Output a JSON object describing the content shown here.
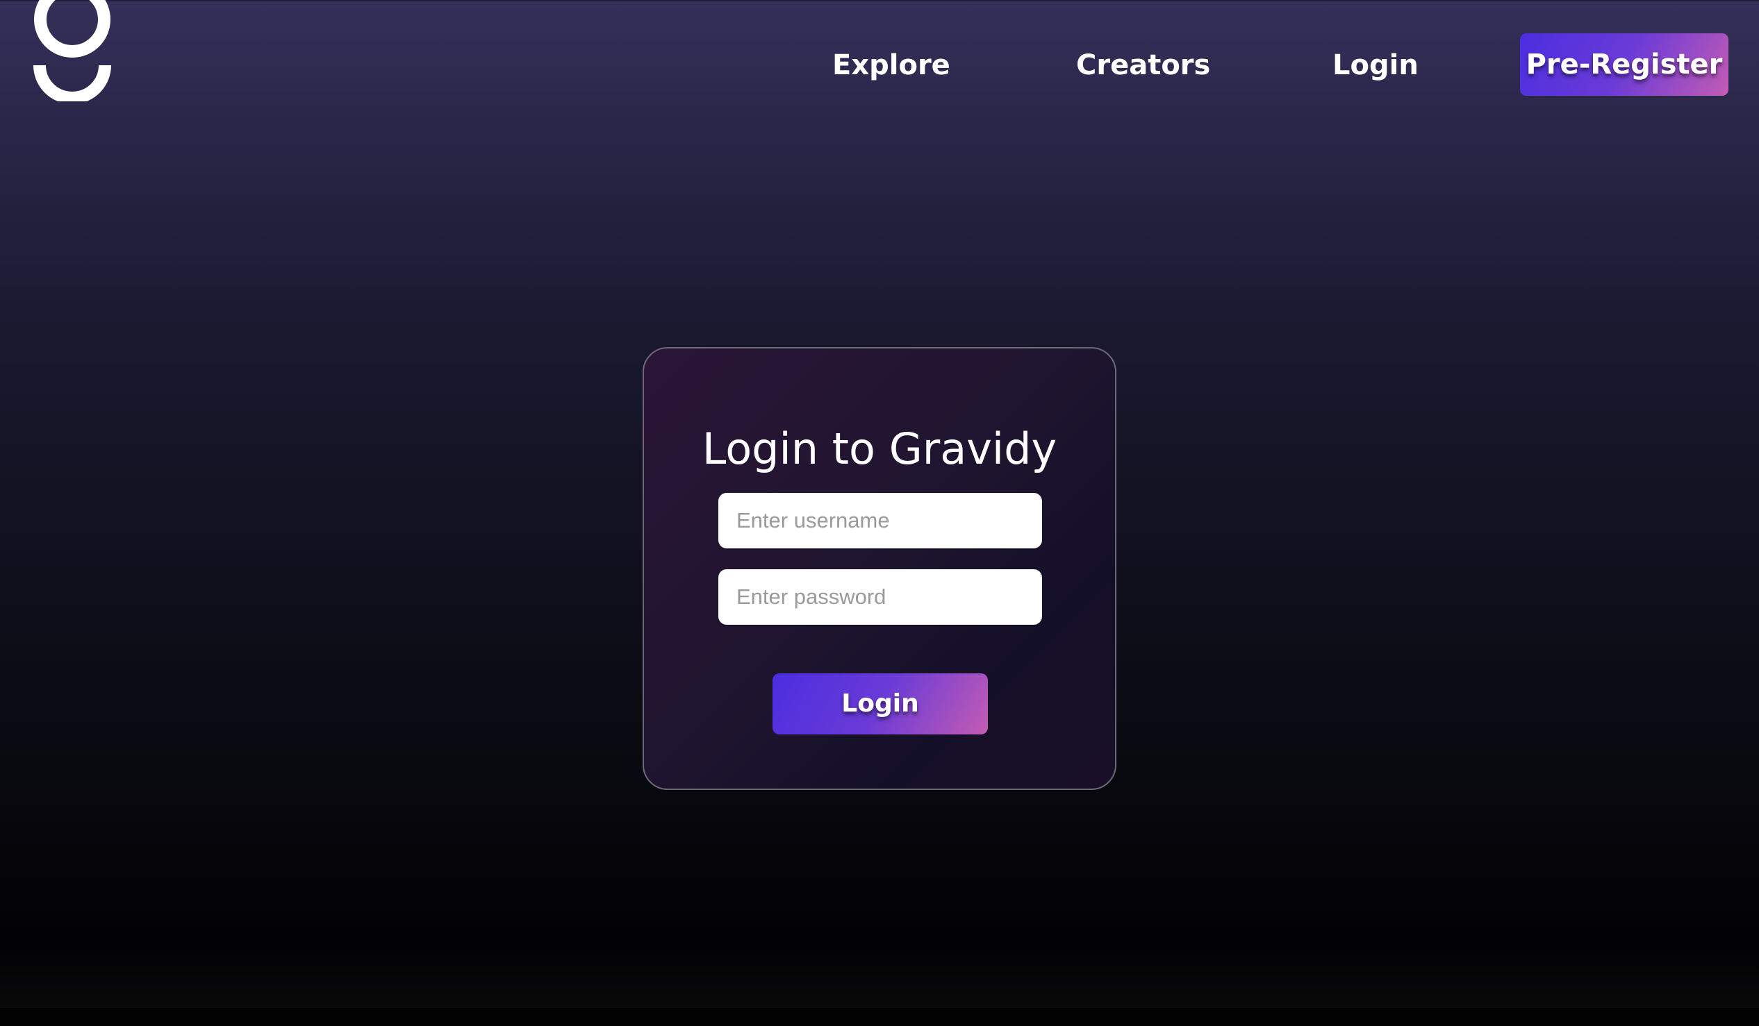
{
  "header": {
    "logo_icon": "gravidy-logo-icon",
    "nav": {
      "explore": "Explore",
      "creators": "Creators",
      "login": "Login"
    },
    "cta_label": "Pre-Register"
  },
  "login_card": {
    "title": "Login to Gravidy",
    "username": {
      "placeholder": "Enter username",
      "value": ""
    },
    "password": {
      "placeholder": "Enter password",
      "value": ""
    },
    "submit_label": "Login"
  },
  "colors": {
    "accent_start": "#4a2ee0",
    "accent_end": "#c45cb4",
    "background_top": "#34305a",
    "background_bottom": "#020204"
  }
}
